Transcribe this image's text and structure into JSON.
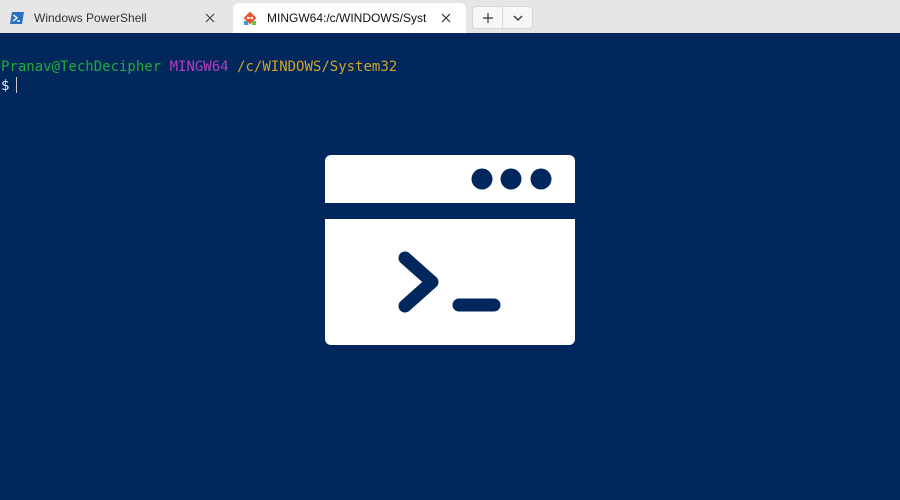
{
  "tabs": [
    {
      "title": "Windows PowerShell",
      "icon": "powershell-icon",
      "active": false
    },
    {
      "title": "MINGW64:/c/WINDOWS/Syst",
      "icon": "git-icon",
      "active": true
    }
  ],
  "tab_actions": {
    "new_tab_icon": "plus-icon",
    "dropdown_icon": "chevron-down-icon"
  },
  "terminal": {
    "prompt_user": "Pranav@TechDecipher",
    "prompt_host": "MINGW64",
    "prompt_path": "/c/WINDOWS/System32",
    "prompt_symbol": "$",
    "colors": {
      "background": "#01275c",
      "user": "#1fae3b",
      "host": "#b43ec1",
      "path": "#d0a32b"
    }
  },
  "illustration": {
    "icon": "terminal-window-icon"
  }
}
